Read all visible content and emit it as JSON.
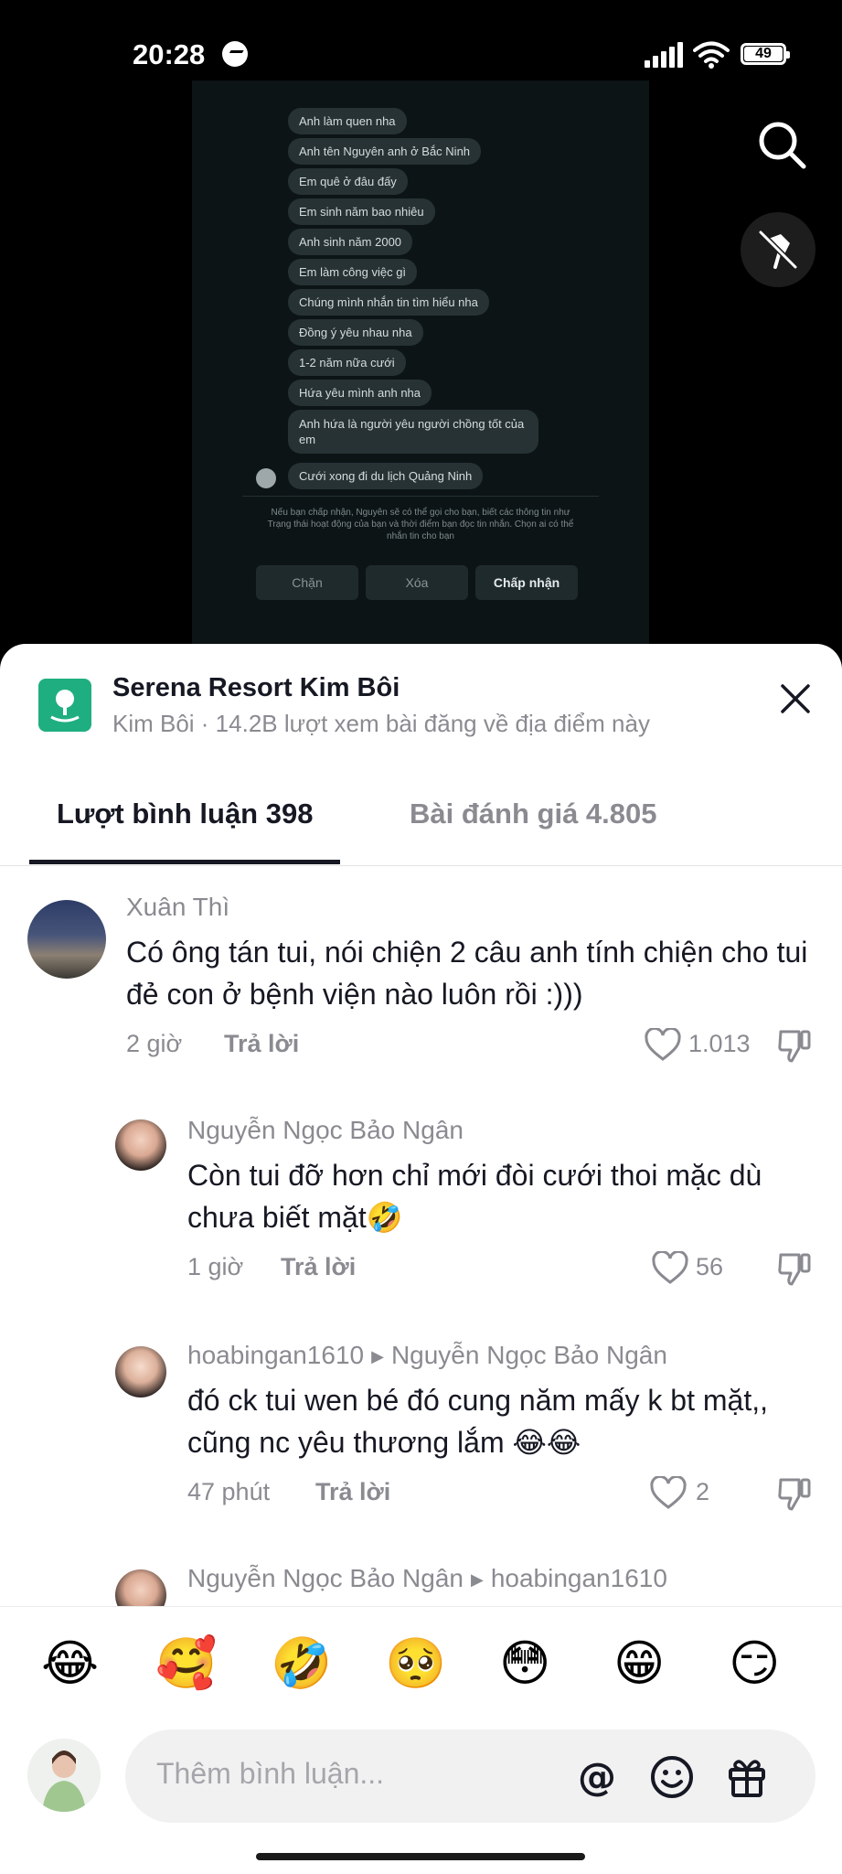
{
  "status": {
    "time": "20:28",
    "battery": "49"
  },
  "video_chat": {
    "messages": [
      "Anh làm quen nha",
      "Anh tên Nguyên anh ở Bắc Ninh",
      "Em quê ở đâu đấy",
      "Em sinh năm bao nhiêu",
      "Anh sinh năm 2000",
      "Em làm công việc gì",
      "Chúng mình nhắn tin tìm hiểu nha",
      "Đồng ý yêu nhau nha",
      "1-2 năm nữa cưới",
      "Hứa yêu mình anh nha",
      "Anh hứa là người yêu người chồng tốt của em",
      "Cưới xong đi du lịch Quảng Ninh"
    ],
    "notice": "Nếu bạn chấp nhận, Nguyên sẽ có thể gọi cho bạn, biết các thông tin như Trạng thái hoạt động của bạn và thời điểm bạn đọc tin nhắn. Chọn ai có thể nhắn tin cho bạn",
    "buttons": {
      "block": "Chặn",
      "delete": "Xóa",
      "accept": "Chấp nhận"
    }
  },
  "place": {
    "title": "Serena Resort Kim Bôi",
    "subtitle": "Kim Bôi · 14.2B lượt xem bài đăng về địa điểm này"
  },
  "tabs": {
    "comments": "Lượt bình luận 398",
    "reviews": "Bài đánh giá 4.805"
  },
  "comments": [
    {
      "name": "Xuân Thì",
      "reply_to": "",
      "text": "Có ông tán tui, nói chiện 2 câu anh tính chiện cho tui đẻ con ở bệnh viện nào luôn rồi :)))",
      "time": "2 giờ",
      "reply_label": "Trả lời",
      "likes": "1.013"
    },
    {
      "name": "Nguyễn Ngọc Bảo Ngân",
      "reply_to": "",
      "text": "Còn tui đỡ hơn chỉ mới đòi cưới thoi mặc dù chưa biết mặt🤣",
      "time": "1 giờ",
      "reply_label": "Trả lời",
      "likes": "56"
    },
    {
      "name": "hoabingan1610",
      "reply_to": "Nguyễn Ngọc Bảo Ngân",
      "text": "đó ck tui wen bé đó cung năm mấy k bt mặt,, cũng nc yêu thương lắm 😂😂",
      "time": "47 phút",
      "reply_label": "Trả lời",
      "likes": "2"
    },
    {
      "name": "Nguyễn Ngọc Bảo Ngân",
      "reply_to": "hoabingan1610"
    }
  ],
  "emojis": [
    "😂",
    "🥰",
    "🤣",
    "🥺",
    "😳",
    "😁",
    "😏"
  ],
  "input": {
    "placeholder": "Thêm bình luận..."
  },
  "colors": {
    "accent_green": "#1fae80",
    "text_dark": "#161823",
    "text_gray": "#8a8b91"
  }
}
